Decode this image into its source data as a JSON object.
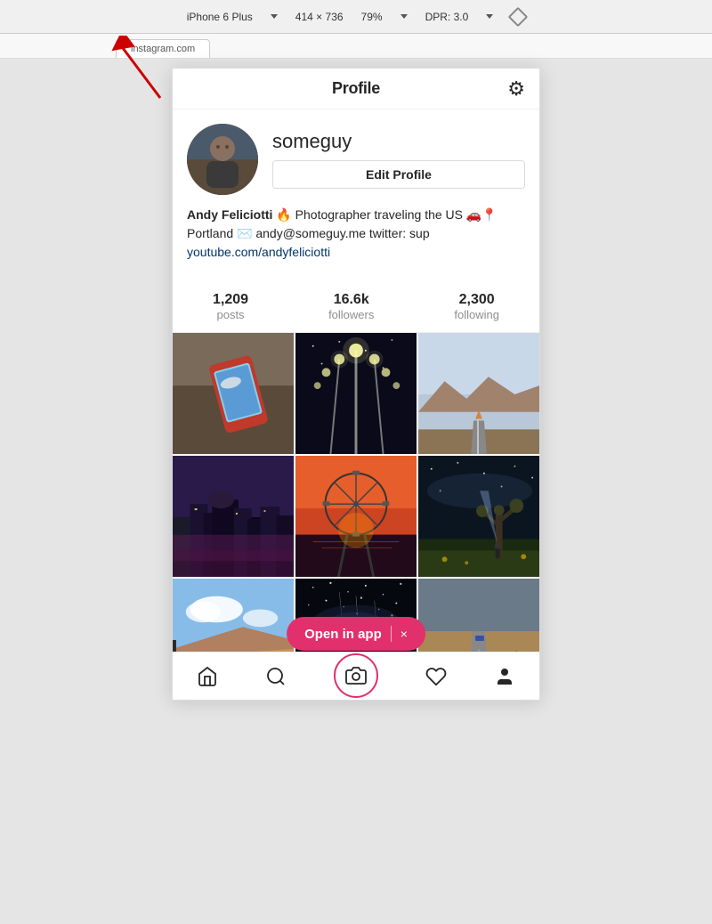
{
  "browser": {
    "device": "iPhone 6 Plus",
    "width": "414",
    "height": "736",
    "zoom": "79%",
    "dpr": "DPR: 3.0"
  },
  "header": {
    "title": "Profile",
    "settings_label": "settings"
  },
  "profile": {
    "username": "someguy",
    "edit_button_label": "Edit Profile",
    "bio_line1": "Andy Feliciotti 🔥 Photographer traveling the US 🚗📍",
    "bio_line2": "Portland ✉️ andy@someguy.me twitter: sup",
    "bio_link": "youtube.com/andyfeliciotti"
  },
  "stats": {
    "posts_count": "1,209",
    "posts_label": "posts",
    "followers_count": "16.6k",
    "followers_label": "followers",
    "following_count": "2,300",
    "following_label": "following"
  },
  "open_in_app": {
    "label": "Open in app",
    "close": "×"
  },
  "nav": {
    "home_label": "home",
    "search_label": "search",
    "camera_label": "camera",
    "heart_label": "activity",
    "profile_label": "profile"
  }
}
